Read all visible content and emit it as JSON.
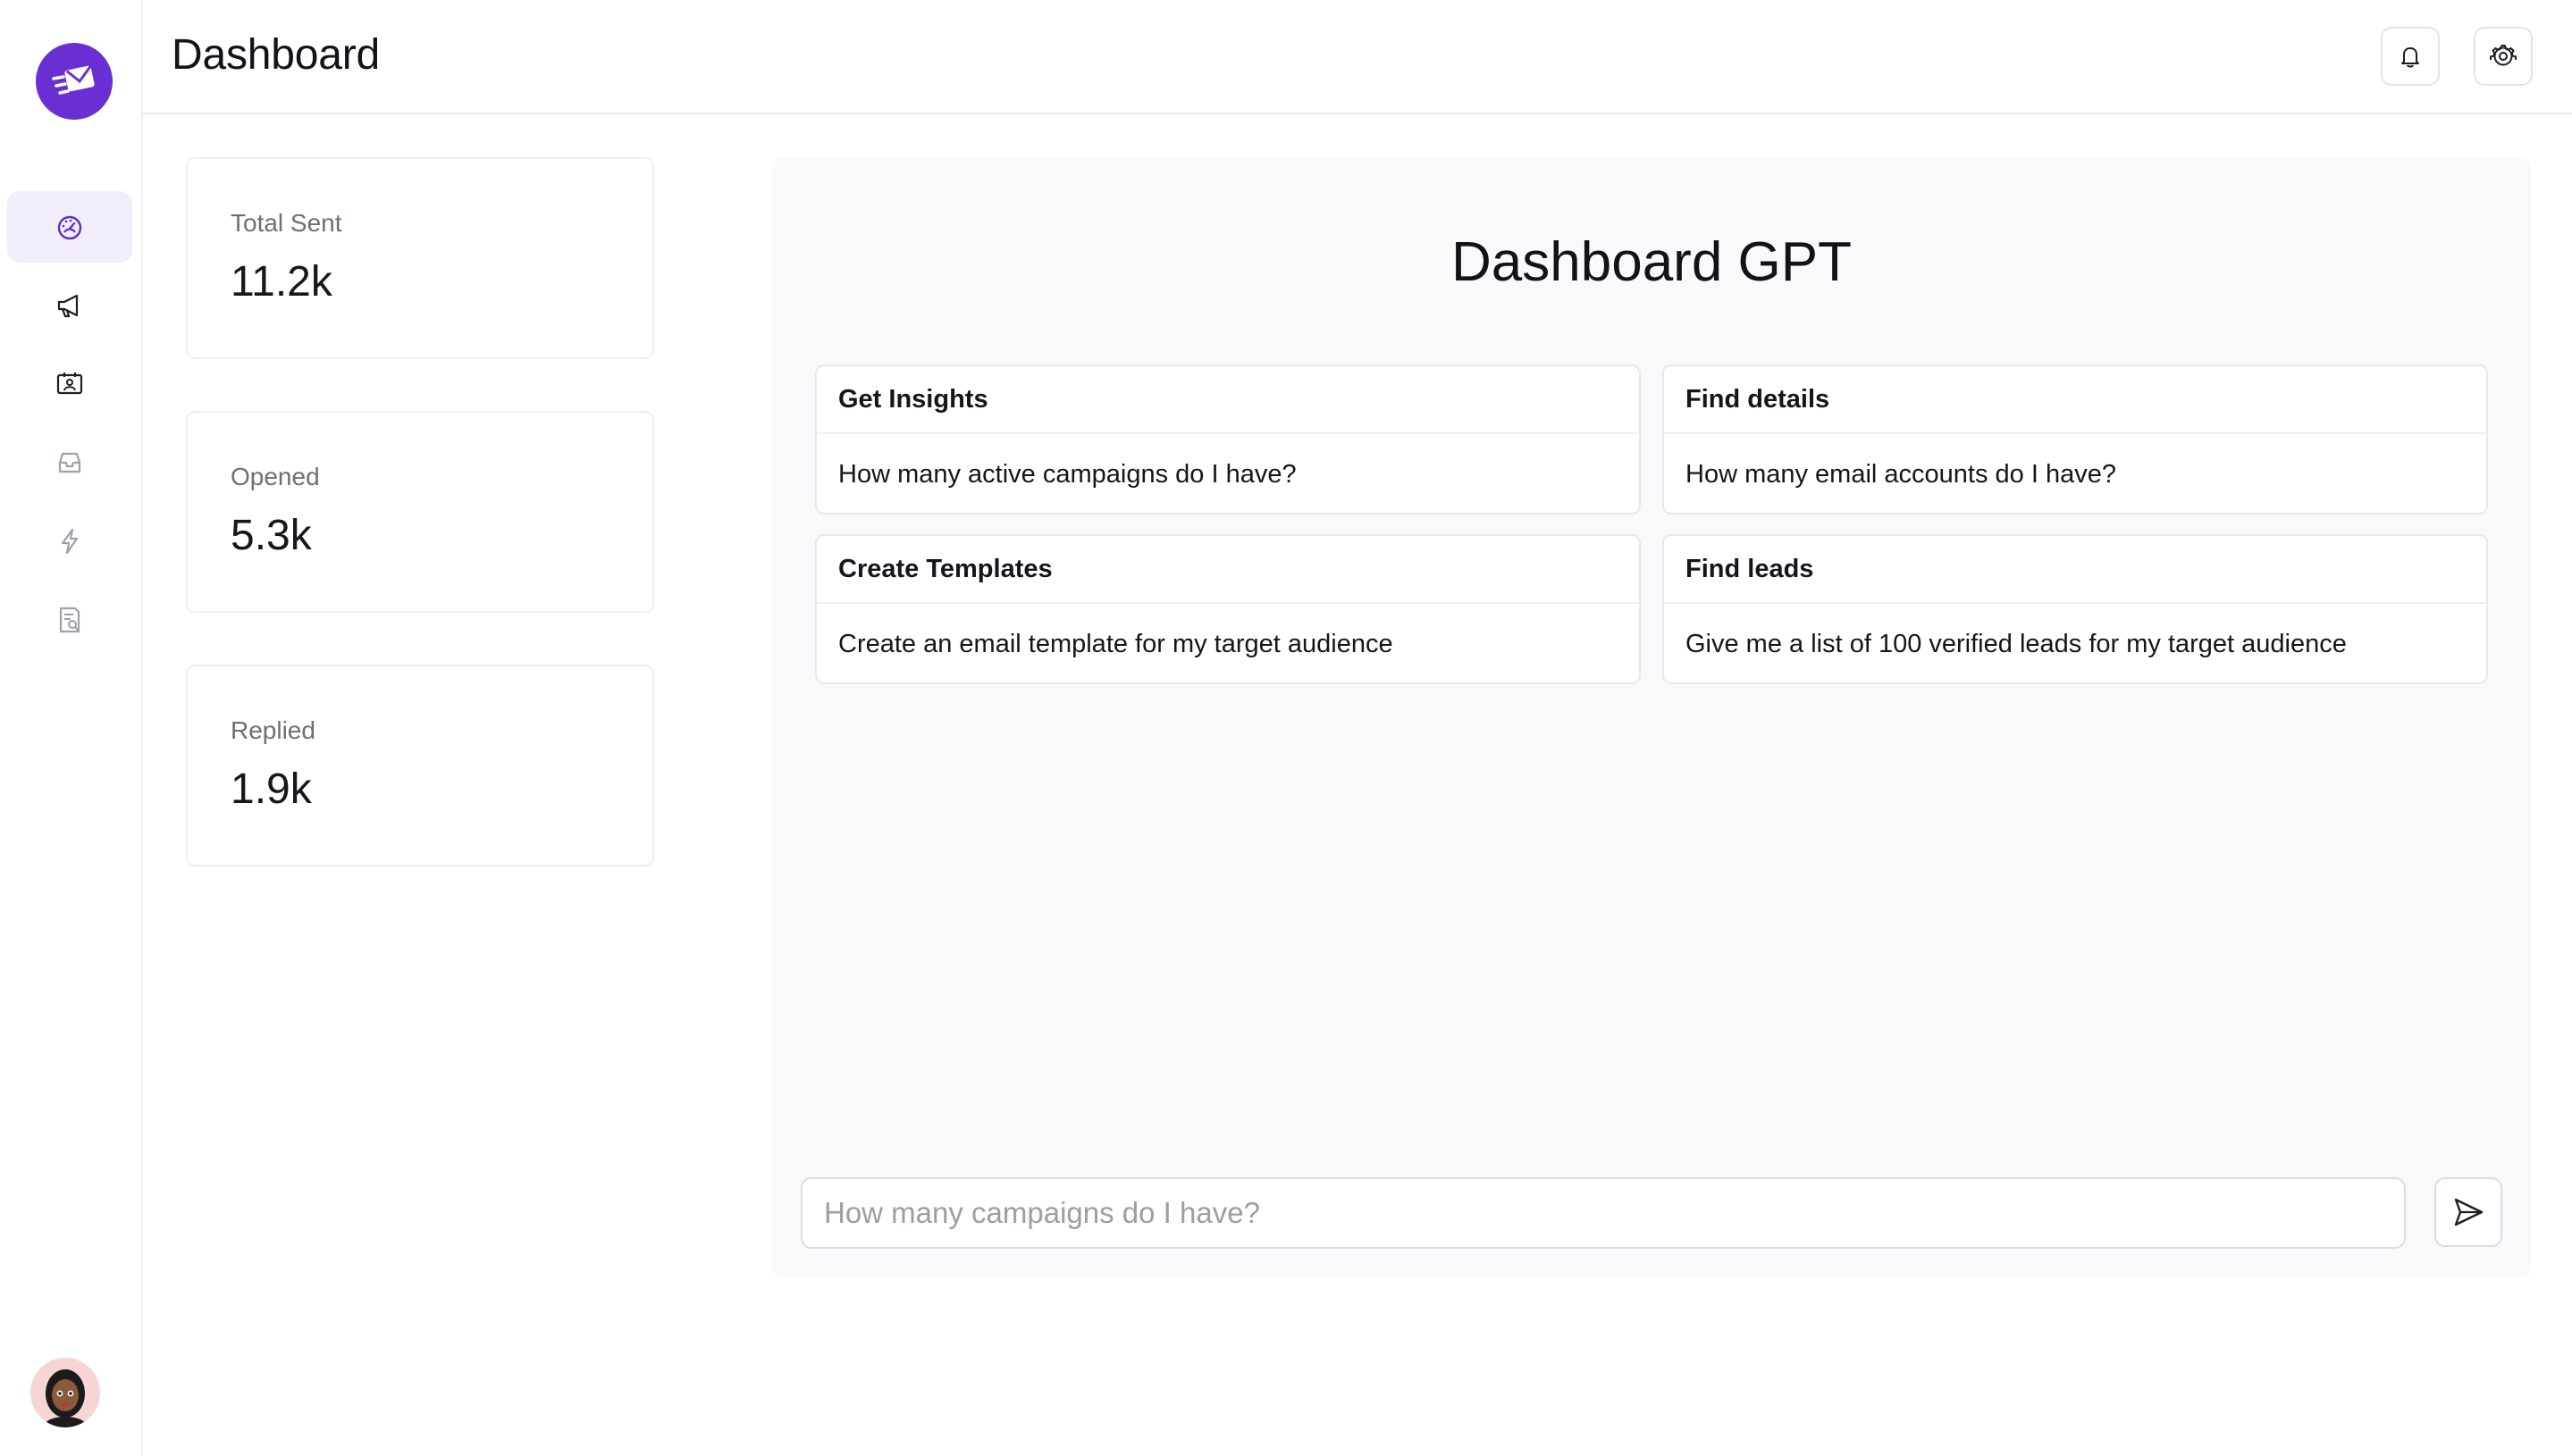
{
  "header": {
    "title": "Dashboard",
    "actions": [
      {
        "icon": "bell-icon"
      },
      {
        "icon": "gear-icon"
      }
    ]
  },
  "sidebar": {
    "logo_icon": "mail-send-icon",
    "active_color": "#6a2fd3",
    "items": [
      {
        "icon": "dashboard-gauge-icon",
        "active": true
      },
      {
        "icon": "megaphone-icon",
        "active": false
      },
      {
        "icon": "contacts-card-icon",
        "active": false
      },
      {
        "icon": "inbox-icon",
        "active": false
      },
      {
        "icon": "lightning-icon",
        "active": false
      },
      {
        "icon": "document-search-icon",
        "active": false
      }
    ],
    "avatar_icon": "user-avatar"
  },
  "stats": [
    {
      "label": "Total Sent",
      "value": "11.2k"
    },
    {
      "label": "Opened",
      "value": "5.3k"
    },
    {
      "label": "Replied",
      "value": "1.9k"
    }
  ],
  "gpt": {
    "title": "Dashboard GPT",
    "prompts": [
      {
        "title": "Get Insights",
        "text": "How many active campaigns do I have?"
      },
      {
        "title": "Find details",
        "text": "How many email accounts do I have?"
      },
      {
        "title": "Create Templates",
        "text": "Create an email template for my target audience"
      },
      {
        "title": "Find leads",
        "text": "Give me a list of 100 verified leads for my target audience"
      }
    ],
    "input": {
      "value": "",
      "placeholder": "How many campaigns do I have?"
    },
    "send_icon": "send-icon"
  }
}
